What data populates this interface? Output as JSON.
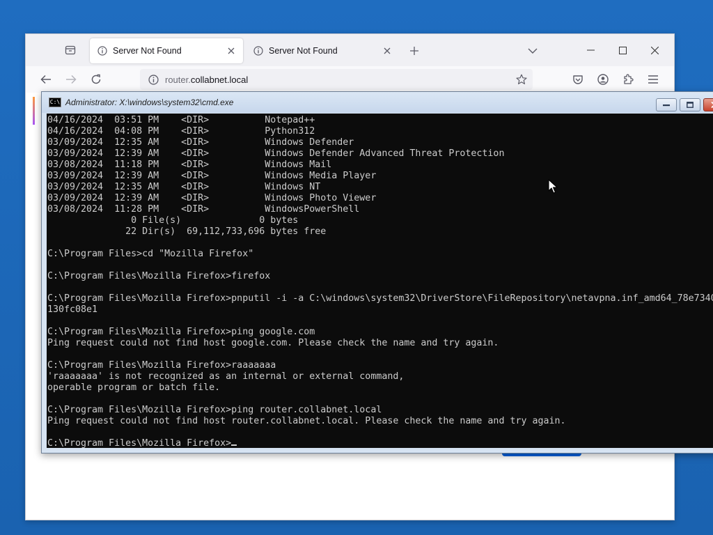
{
  "browser": {
    "tabs": [
      {
        "label": "Server Not Found",
        "active": true
      },
      {
        "label": "Server Not Found",
        "active": false
      }
    ],
    "url": {
      "prefix": "router.",
      "domain": "collabnet.local"
    }
  },
  "cmd": {
    "title": "Administrator: X:\\windows\\system32\\cmd.exe",
    "icon_text": "C:\\",
    "lines": [
      "04/16/2024  03:51 PM    <DIR>          Notepad++",
      "04/16/2024  04:08 PM    <DIR>          Python312",
      "03/09/2024  12:35 AM    <DIR>          Windows Defender",
      "03/09/2024  12:39 AM    <DIR>          Windows Defender Advanced Threat Protection",
      "03/08/2024  11:18 PM    <DIR>          Windows Mail",
      "03/09/2024  12:39 AM    <DIR>          Windows Media Player",
      "03/09/2024  12:35 AM    <DIR>          Windows NT",
      "03/09/2024  12:39 AM    <DIR>          Windows Photo Viewer",
      "03/08/2024  11:28 PM    <DIR>          WindowsPowerShell",
      "               0 File(s)              0 bytes",
      "              22 Dir(s)  69,112,733,696 bytes free",
      "",
      "C:\\Program Files>cd \"Mozilla Firefox\"",
      "",
      "C:\\Program Files\\Mozilla Firefox>firefox",
      "",
      "C:\\Program Files\\Mozilla Firefox>pnputil -i -a C:\\windows\\system32\\DriverStore\\FileRepository\\netavpna.inf_amd64_78e7340",
      "130fc08e1",
      "",
      "C:\\Program Files\\Mozilla Firefox>ping google.com",
      "Ping request could not find host google.com. Please check the name and try again.",
      "",
      "C:\\Program Files\\Mozilla Firefox>raaaaaaa",
      "'raaaaaaa' is not recognized as an internal or external command,",
      "operable program or batch file.",
      "",
      "C:\\Program Files\\Mozilla Firefox>ping router.collabnet.local",
      "Ping request could not find host router.collabnet.local. Please check the name and try again.",
      ""
    ],
    "prompt": "C:\\Program Files\\Mozilla Firefox>"
  },
  "colors": {
    "desktop": "#1c66b8",
    "console_bg": "#0c0c0c",
    "console_fg": "#cccccc",
    "accent_blue": "#0061e0"
  }
}
